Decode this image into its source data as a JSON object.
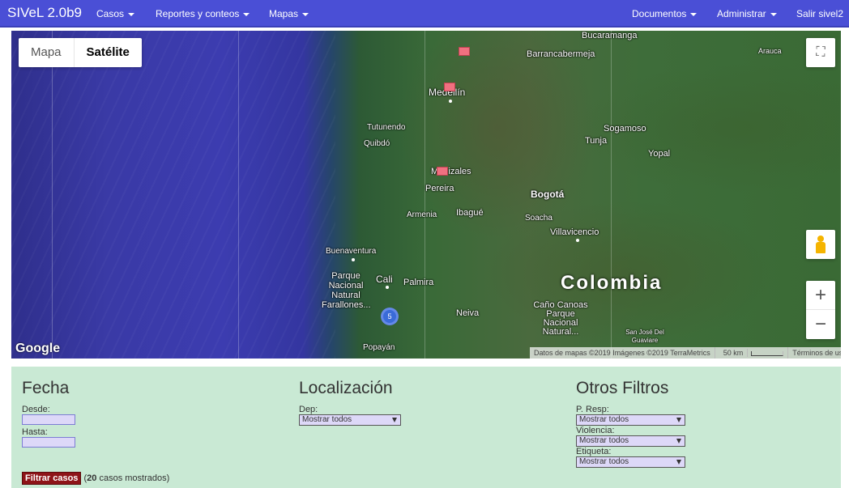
{
  "navbar": {
    "brand": "SIVeL 2.0b9",
    "menus": [
      "Casos",
      "Reportes y conteos",
      "Mapas"
    ],
    "right_menus": [
      "Documentos",
      "Administrar"
    ],
    "logout": "Salir sivel2"
  },
  "map": {
    "type_buttons": {
      "map": "Mapa",
      "satellite": "Satélite"
    },
    "selected_type": "Satélite",
    "country_label": "Colombia",
    "cities": [
      "Bucaramanga",
      "Barrancabermeja",
      "Arauca",
      "Medellín",
      "Tutunendo",
      "Quibdó",
      "Sogamoso",
      "Tunja",
      "Yopal",
      "Manizales",
      "Pereira",
      "Bogotá",
      "Armenia",
      "Ibagué",
      "Soacha",
      "Villavicencio",
      "Buenaventura",
      "Cali",
      "Palmira",
      "Parque Nacional Natural Farallones...",
      "Neiva",
      "Caño Canoas Parque Nacional Natural...",
      "San José Del Guaviare",
      "Popayán"
    ],
    "cluster_count": "5",
    "google_logo": "Google",
    "attribution": {
      "data": "Datos de mapas ©2019 Imágenes ©2019 TerraMetrics",
      "scale": "50 km",
      "terms": "Términos de uso"
    }
  },
  "filters": {
    "fecha": {
      "title": "Fecha",
      "desde": "Desde:",
      "hasta": "Hasta:"
    },
    "localizacion": {
      "title": "Localización",
      "dep_label": "Dep:",
      "dep_value": "Mostrar todos"
    },
    "otros": {
      "title": "Otros Filtros",
      "presp_label": "P. Resp:",
      "presp_value": "Mostrar todos",
      "violencia_label": "Violencia:",
      "violencia_value": "Mostrar todos",
      "etiqueta_label": "Etiqueta:",
      "etiqueta_value": "Mostrar todos"
    },
    "button_label": "Filtrar casos",
    "result_count": "20",
    "result_suffix": "casos mostrados"
  }
}
